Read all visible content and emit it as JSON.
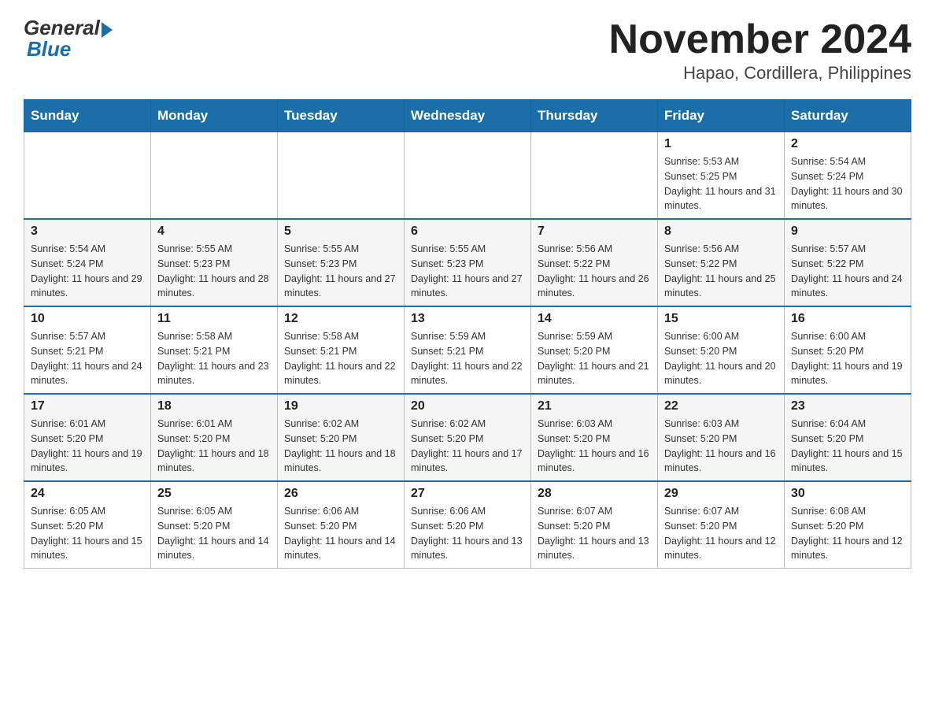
{
  "header": {
    "logo_general": "General",
    "logo_blue": "Blue",
    "title": "November 2024",
    "subtitle": "Hapao, Cordillera, Philippines"
  },
  "weekdays": [
    "Sunday",
    "Monday",
    "Tuesday",
    "Wednesday",
    "Thursday",
    "Friday",
    "Saturday"
  ],
  "weeks": [
    [
      {
        "day": "",
        "info": ""
      },
      {
        "day": "",
        "info": ""
      },
      {
        "day": "",
        "info": ""
      },
      {
        "day": "",
        "info": ""
      },
      {
        "day": "",
        "info": ""
      },
      {
        "day": "1",
        "info": "Sunrise: 5:53 AM\nSunset: 5:25 PM\nDaylight: 11 hours and 31 minutes."
      },
      {
        "day": "2",
        "info": "Sunrise: 5:54 AM\nSunset: 5:24 PM\nDaylight: 11 hours and 30 minutes."
      }
    ],
    [
      {
        "day": "3",
        "info": "Sunrise: 5:54 AM\nSunset: 5:24 PM\nDaylight: 11 hours and 29 minutes."
      },
      {
        "day": "4",
        "info": "Sunrise: 5:55 AM\nSunset: 5:23 PM\nDaylight: 11 hours and 28 minutes."
      },
      {
        "day": "5",
        "info": "Sunrise: 5:55 AM\nSunset: 5:23 PM\nDaylight: 11 hours and 27 minutes."
      },
      {
        "day": "6",
        "info": "Sunrise: 5:55 AM\nSunset: 5:23 PM\nDaylight: 11 hours and 27 minutes."
      },
      {
        "day": "7",
        "info": "Sunrise: 5:56 AM\nSunset: 5:22 PM\nDaylight: 11 hours and 26 minutes."
      },
      {
        "day": "8",
        "info": "Sunrise: 5:56 AM\nSunset: 5:22 PM\nDaylight: 11 hours and 25 minutes."
      },
      {
        "day": "9",
        "info": "Sunrise: 5:57 AM\nSunset: 5:22 PM\nDaylight: 11 hours and 24 minutes."
      }
    ],
    [
      {
        "day": "10",
        "info": "Sunrise: 5:57 AM\nSunset: 5:21 PM\nDaylight: 11 hours and 24 minutes."
      },
      {
        "day": "11",
        "info": "Sunrise: 5:58 AM\nSunset: 5:21 PM\nDaylight: 11 hours and 23 minutes."
      },
      {
        "day": "12",
        "info": "Sunrise: 5:58 AM\nSunset: 5:21 PM\nDaylight: 11 hours and 22 minutes."
      },
      {
        "day": "13",
        "info": "Sunrise: 5:59 AM\nSunset: 5:21 PM\nDaylight: 11 hours and 22 minutes."
      },
      {
        "day": "14",
        "info": "Sunrise: 5:59 AM\nSunset: 5:20 PM\nDaylight: 11 hours and 21 minutes."
      },
      {
        "day": "15",
        "info": "Sunrise: 6:00 AM\nSunset: 5:20 PM\nDaylight: 11 hours and 20 minutes."
      },
      {
        "day": "16",
        "info": "Sunrise: 6:00 AM\nSunset: 5:20 PM\nDaylight: 11 hours and 19 minutes."
      }
    ],
    [
      {
        "day": "17",
        "info": "Sunrise: 6:01 AM\nSunset: 5:20 PM\nDaylight: 11 hours and 19 minutes."
      },
      {
        "day": "18",
        "info": "Sunrise: 6:01 AM\nSunset: 5:20 PM\nDaylight: 11 hours and 18 minutes."
      },
      {
        "day": "19",
        "info": "Sunrise: 6:02 AM\nSunset: 5:20 PM\nDaylight: 11 hours and 18 minutes."
      },
      {
        "day": "20",
        "info": "Sunrise: 6:02 AM\nSunset: 5:20 PM\nDaylight: 11 hours and 17 minutes."
      },
      {
        "day": "21",
        "info": "Sunrise: 6:03 AM\nSunset: 5:20 PM\nDaylight: 11 hours and 16 minutes."
      },
      {
        "day": "22",
        "info": "Sunrise: 6:03 AM\nSunset: 5:20 PM\nDaylight: 11 hours and 16 minutes."
      },
      {
        "day": "23",
        "info": "Sunrise: 6:04 AM\nSunset: 5:20 PM\nDaylight: 11 hours and 15 minutes."
      }
    ],
    [
      {
        "day": "24",
        "info": "Sunrise: 6:05 AM\nSunset: 5:20 PM\nDaylight: 11 hours and 15 minutes."
      },
      {
        "day": "25",
        "info": "Sunrise: 6:05 AM\nSunset: 5:20 PM\nDaylight: 11 hours and 14 minutes."
      },
      {
        "day": "26",
        "info": "Sunrise: 6:06 AM\nSunset: 5:20 PM\nDaylight: 11 hours and 14 minutes."
      },
      {
        "day": "27",
        "info": "Sunrise: 6:06 AM\nSunset: 5:20 PM\nDaylight: 11 hours and 13 minutes."
      },
      {
        "day": "28",
        "info": "Sunrise: 6:07 AM\nSunset: 5:20 PM\nDaylight: 11 hours and 13 minutes."
      },
      {
        "day": "29",
        "info": "Sunrise: 6:07 AM\nSunset: 5:20 PM\nDaylight: 11 hours and 12 minutes."
      },
      {
        "day": "30",
        "info": "Sunrise: 6:08 AM\nSunset: 5:20 PM\nDaylight: 11 hours and 12 minutes."
      }
    ]
  ]
}
